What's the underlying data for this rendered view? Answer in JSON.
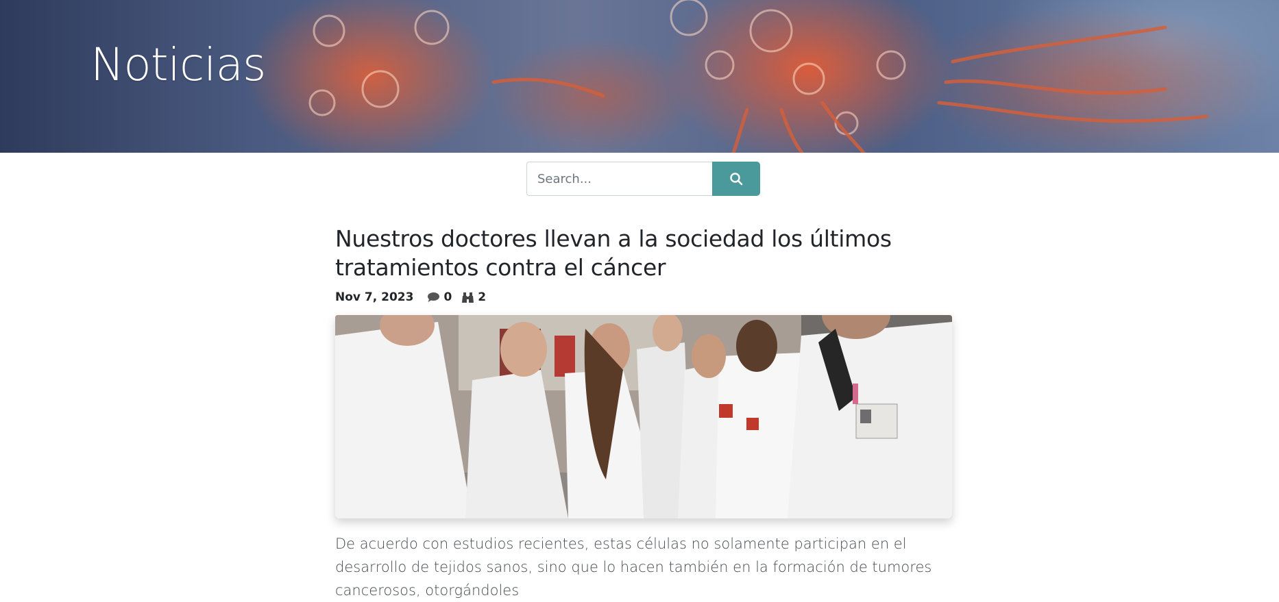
{
  "hero": {
    "title": "Noticias"
  },
  "search": {
    "placeholder": "Search..."
  },
  "article": {
    "title": "Nuestros doctores llevan a la sociedad los últimos tratamientos contra el cáncer",
    "date": "Nov 7, 2023",
    "comments": "0",
    "views": "2",
    "excerpt": "De acuerdo con estudios recientes, estas células no solamente participan en el desarrollo de tejidos sanos, sino que lo hacen también en la formación de tumores cancerosos, otorgándoles"
  },
  "icons": {
    "search": "search-icon",
    "comments": "comment-icon",
    "views": "binoculars-icon"
  },
  "colors": {
    "accent": "#4a9a9c",
    "text": "#212529",
    "muted_text": "#444a50"
  }
}
